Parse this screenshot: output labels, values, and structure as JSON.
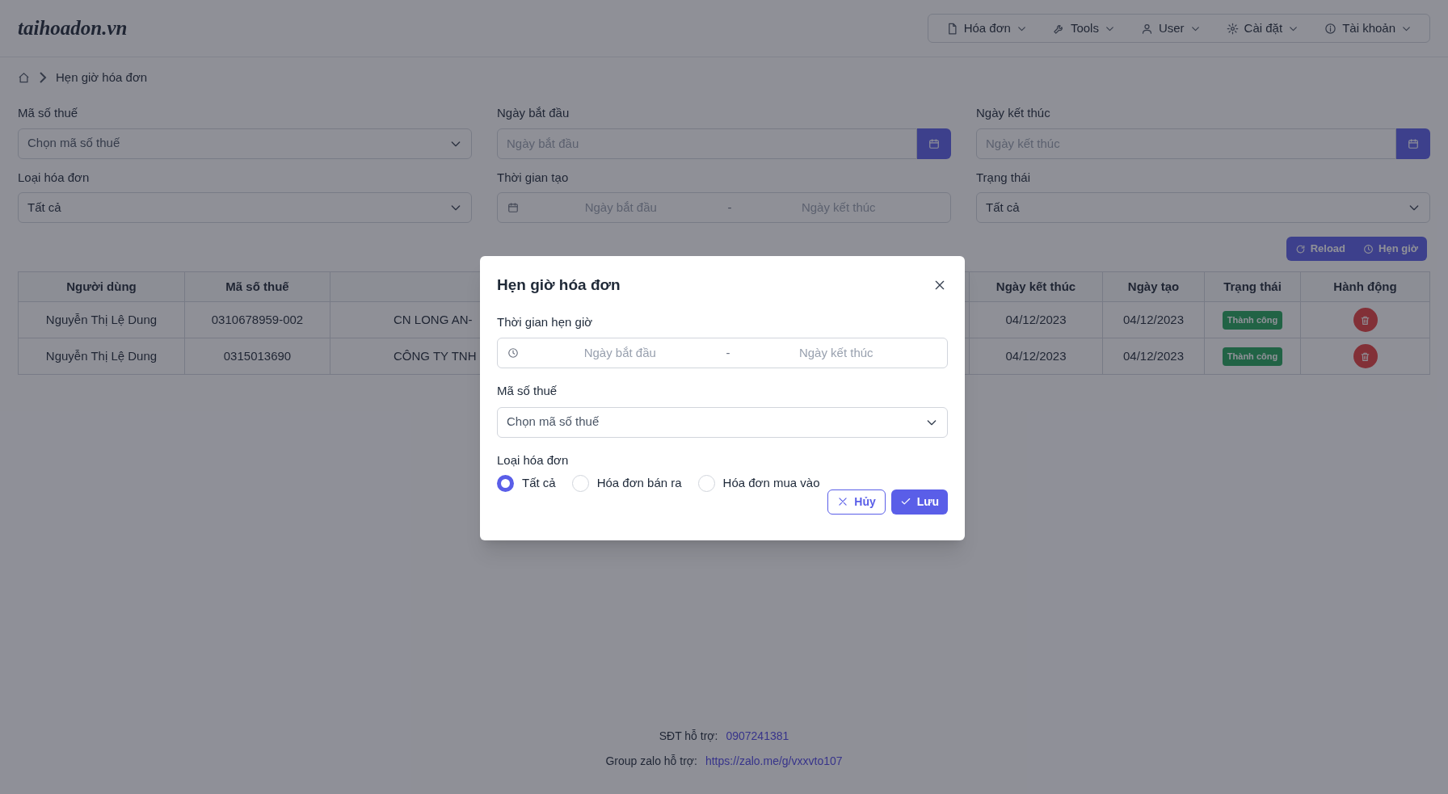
{
  "header": {
    "logo": "taihoadon.vn",
    "menu": [
      {
        "label": "Hóa đơn"
      },
      {
        "label": "Tools"
      },
      {
        "label": "User"
      },
      {
        "label": "Cài đặt"
      },
      {
        "label": "Tài khoản"
      }
    ]
  },
  "breadcrumb": {
    "current": "Hẹn giờ hóa đơn"
  },
  "filters": [
    {
      "label": "Mã số thuế",
      "kind": "select",
      "placeholder": "Chọn mã số thuế"
    },
    {
      "label": "Ngày bắt đầu",
      "kind": "date",
      "placeholder": "Ngày bắt đầu"
    },
    {
      "label": "Ngày kết thúc",
      "kind": "date",
      "placeholder": "Ngày kết thúc"
    },
    {
      "label": "Loại hóa đơn",
      "kind": "select",
      "value": "Tất cả"
    },
    {
      "label": "Thời gian tạo",
      "kind": "range",
      "start_placeholder": "Ngày bắt đầu",
      "separator": "-",
      "end_placeholder": "Ngày kết thúc"
    },
    {
      "label": "Trạng thái",
      "kind": "select",
      "value": "Tất cả"
    }
  ],
  "actions": [
    {
      "label": "Reload"
    },
    {
      "label": "Hẹn giờ"
    }
  ],
  "table": {
    "columns": {
      "user": "Người dùng",
      "tax_code": "Mã số thuế",
      "end_date": "Ngày kết thúc",
      "created_date": "Ngày tạo",
      "status": "Trạng thái",
      "actions": "Hành động"
    },
    "rows": [
      {
        "user": "Nguyễn Thị Lệ Dung",
        "tax_code": "0310678959-002",
        "column_3": "CN LONG AN-",
        "end_date": "04/12/2023",
        "created_date": "04/12/2023",
        "status": "Thành công"
      },
      {
        "user": "Nguyễn Thị Lệ Dung",
        "tax_code": "0315013690",
        "column_3": "CÔNG TY TNH",
        "end_date": "04/12/2023",
        "created_date": "04/12/2023",
        "status": "Thành công"
      }
    ]
  },
  "modal": {
    "title": "Hẹn giờ hóa đơn",
    "fields": [
      {
        "label": "Thời gian hẹn giờ",
        "kind": "range",
        "start_placeholder": "Ngày bắt đầu",
        "separator": "-",
        "end_placeholder": "Ngày kết thúc"
      },
      {
        "label": "Mã số thuế",
        "kind": "select",
        "placeholder": "Chọn mã số thuế"
      },
      {
        "label": "Loại hóa đơn",
        "kind": "radio",
        "options": [
          {
            "label": "Tất cả",
            "selected": true
          },
          {
            "label": "Hóa đơn bán ra",
            "selected": false
          },
          {
            "label": "Hóa đơn mua vào",
            "selected": false
          }
        ]
      }
    ],
    "buttons": [
      {
        "label": "Hủy",
        "kind": "secondary"
      },
      {
        "label": "Lưu",
        "kind": "primary"
      }
    ]
  },
  "footer": [
    {
      "label": "SĐT hỗ trợ:",
      "link": "0907241381"
    },
    {
      "label": "Group zalo hỗ trợ:",
      "link": "https://zalo.me/g/vxxvto107"
    }
  ]
}
